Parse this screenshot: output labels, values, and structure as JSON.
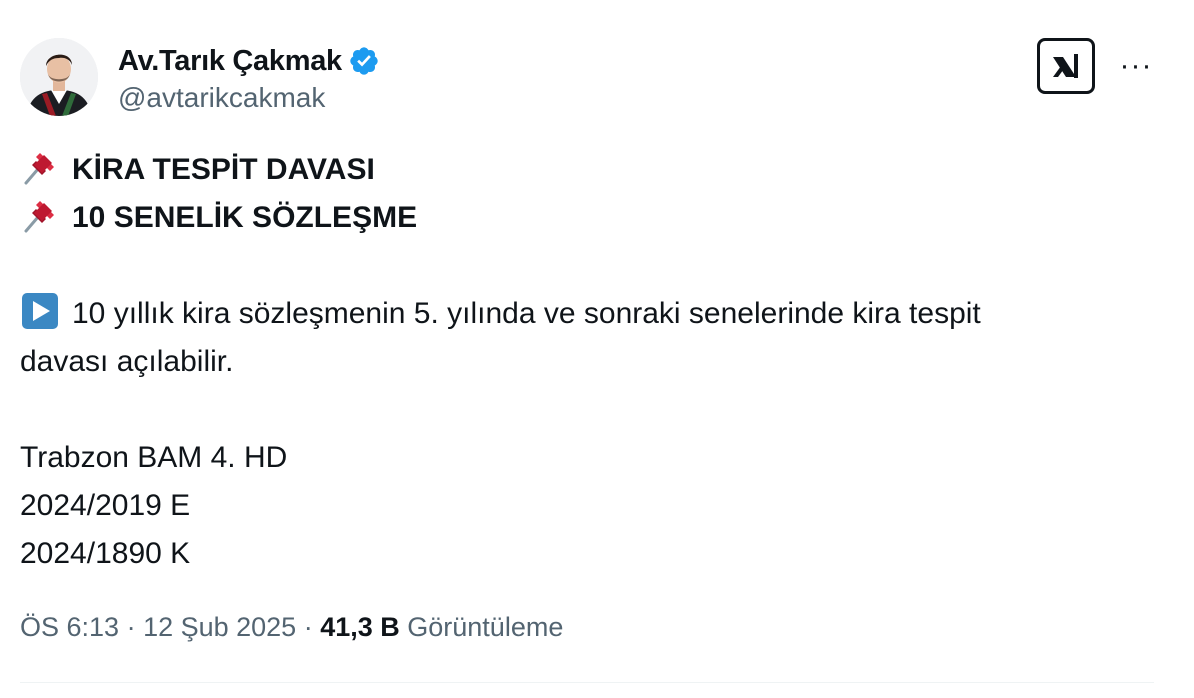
{
  "author": {
    "display_name": "Av.Tarık Çakmak",
    "handle": "@avtarikcakmak",
    "verified_badge": "verified-check-icon",
    "avatar": "profile-photo"
  },
  "actions": {
    "xai_icon": "grok-xai-icon",
    "more_label": "···"
  },
  "tweet": {
    "line1": "KİRA TESPİT DAVASI",
    "line2": "10 SENELİK SÖZLEŞME",
    "line3": "10 yıllık kira sözleşmenin 5. yılında ve sonraki senelerinde kira tespit",
    "line4": "davası açılabilir.",
    "line5": "Trabzon BAM 4. HD",
    "line6": "2024/2019 E",
    "line7": "2024/1890 K",
    "emoji_pin": "pushpin-icon",
    "emoji_play": "play-button-icon"
  },
  "meta": {
    "time": "ÖS 6:13",
    "sep1": " · ",
    "date": "12 Şub 2025",
    "sep2": " · ",
    "views_count": "41,3 B",
    "views_label": " Görüntüleme"
  },
  "colors": {
    "verified_blue": "#1d9bf0",
    "text_primary": "#0f1419",
    "text_secondary": "#536471",
    "play_blue": "#3b88c3",
    "pin_red": "#be1931"
  }
}
